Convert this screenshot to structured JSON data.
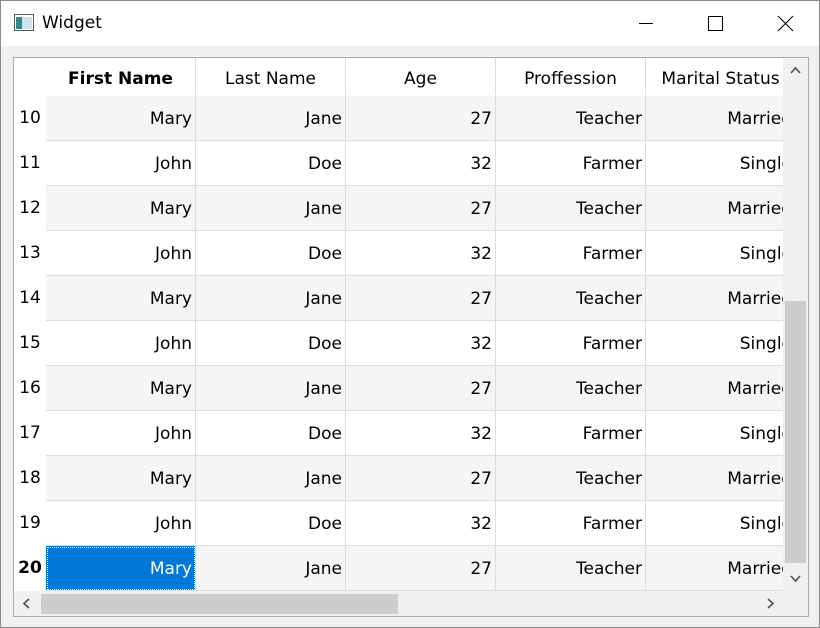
{
  "window": {
    "title": "Widget"
  },
  "columns": [
    "First Name",
    "Last Name",
    "Age",
    "Proffession",
    "Marital Status"
  ],
  "rows": [
    {
      "num": "10",
      "cells": [
        "Mary",
        "Jane",
        "27",
        "Teacher",
        "Married"
      ]
    },
    {
      "num": "11",
      "cells": [
        "John",
        "Doe",
        "32",
        "Farmer",
        "Single"
      ]
    },
    {
      "num": "12",
      "cells": [
        "Mary",
        "Jane",
        "27",
        "Teacher",
        "Married"
      ]
    },
    {
      "num": "13",
      "cells": [
        "John",
        "Doe",
        "32",
        "Farmer",
        "Single"
      ]
    },
    {
      "num": "14",
      "cells": [
        "Mary",
        "Jane",
        "27",
        "Teacher",
        "Married"
      ]
    },
    {
      "num": "15",
      "cells": [
        "John",
        "Doe",
        "32",
        "Farmer",
        "Single"
      ]
    },
    {
      "num": "16",
      "cells": [
        "Mary",
        "Jane",
        "27",
        "Teacher",
        "Married"
      ]
    },
    {
      "num": "17",
      "cells": [
        "John",
        "Doe",
        "32",
        "Farmer",
        "Single"
      ]
    },
    {
      "num": "18",
      "cells": [
        "Mary",
        "Jane",
        "27",
        "Teacher",
        "Married"
      ]
    },
    {
      "num": "19",
      "cells": [
        "John",
        "Doe",
        "32",
        "Farmer",
        "Single"
      ]
    },
    {
      "num": "20",
      "cells": [
        "Mary",
        "Jane",
        "27",
        "Teacher",
        "Married"
      ]
    }
  ],
  "selection": {
    "row": 10,
    "col": 0
  },
  "colors": {
    "selection": "#0078d7",
    "alt_row": "#f5f5f5",
    "grid_line": "#dcdcdc",
    "scroll_thumb": "#cdcdcd"
  },
  "icons": {
    "app": "app-window-icon",
    "minimize": "minimize-icon",
    "maximize": "maximize-icon",
    "close": "close-icon",
    "scroll_up": "chevron-up-icon",
    "scroll_down": "chevron-down-icon",
    "scroll_left": "chevron-left-icon",
    "scroll_right": "chevron-right-icon"
  }
}
